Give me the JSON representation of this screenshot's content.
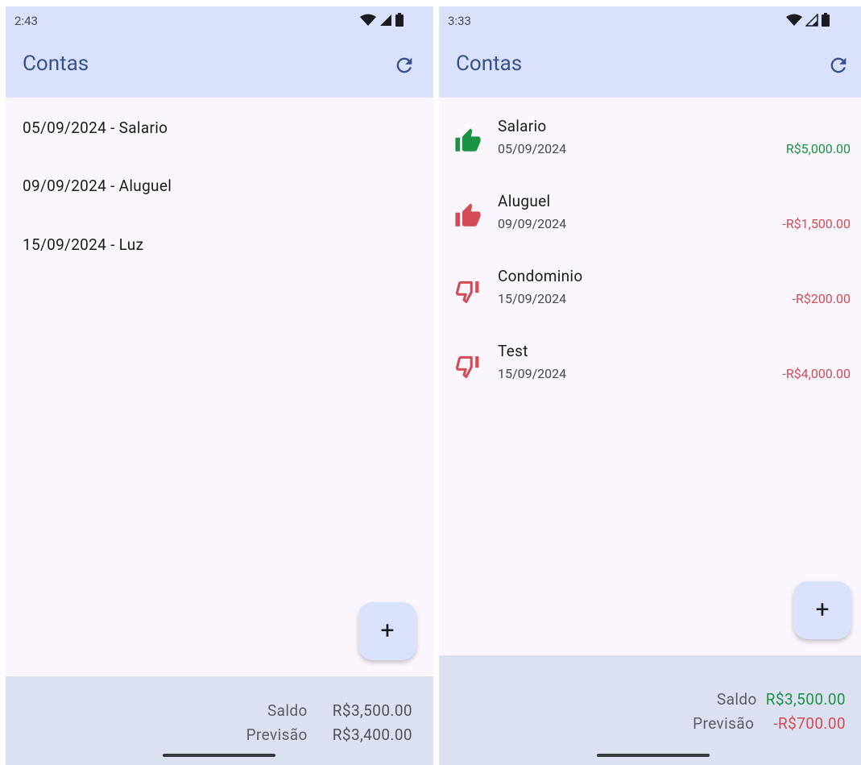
{
  "left": {
    "status_time": "2:43",
    "title": "Contas",
    "items": [
      {
        "label": "05/09/2024 - Salario"
      },
      {
        "label": "09/09/2024 - Aluguel"
      },
      {
        "label": "15/09/2024 - Luz"
      }
    ],
    "fab_label": "+",
    "footer": {
      "saldo_label": "Saldo",
      "saldo_value": "R$3,500.00",
      "previsao_label": "Previsão",
      "previsao_value": "R$3,400.00"
    }
  },
  "right": {
    "status_time": "3:33",
    "title": "Contas",
    "transactions": [
      {
        "name": "Salario",
        "date": "05/09/2024",
        "amount": "R$5,000.00",
        "icon": "thumb-up-filled-icon",
        "color": "#1a9443"
      },
      {
        "name": "Aluguel",
        "date": "09/09/2024",
        "amount": "-R$1,500.00",
        "icon": "thumb-up-filled-icon",
        "color": "#d24b55"
      },
      {
        "name": "Condominio",
        "date": "15/09/2024",
        "amount": "-R$200.00",
        "icon": "thumb-down-outline-icon",
        "color": "#d24b55"
      },
      {
        "name": "Test",
        "date": "15/09/2024",
        "amount": "-R$4,000.00",
        "icon": "thumb-down-outline-icon",
        "color": "#d24b55"
      }
    ],
    "fab_label": "+",
    "footer": {
      "saldo_label": "Saldo",
      "saldo_value": "R$3,500.00",
      "previsao_label": "Previsão",
      "previsao_value": "-R$700.00"
    }
  },
  "colors": {
    "app_bar": "#d9e1fb",
    "title": "#3b5189",
    "positive": "#1a9443",
    "negative": "#d24b55",
    "footer": "#dce1f2"
  }
}
